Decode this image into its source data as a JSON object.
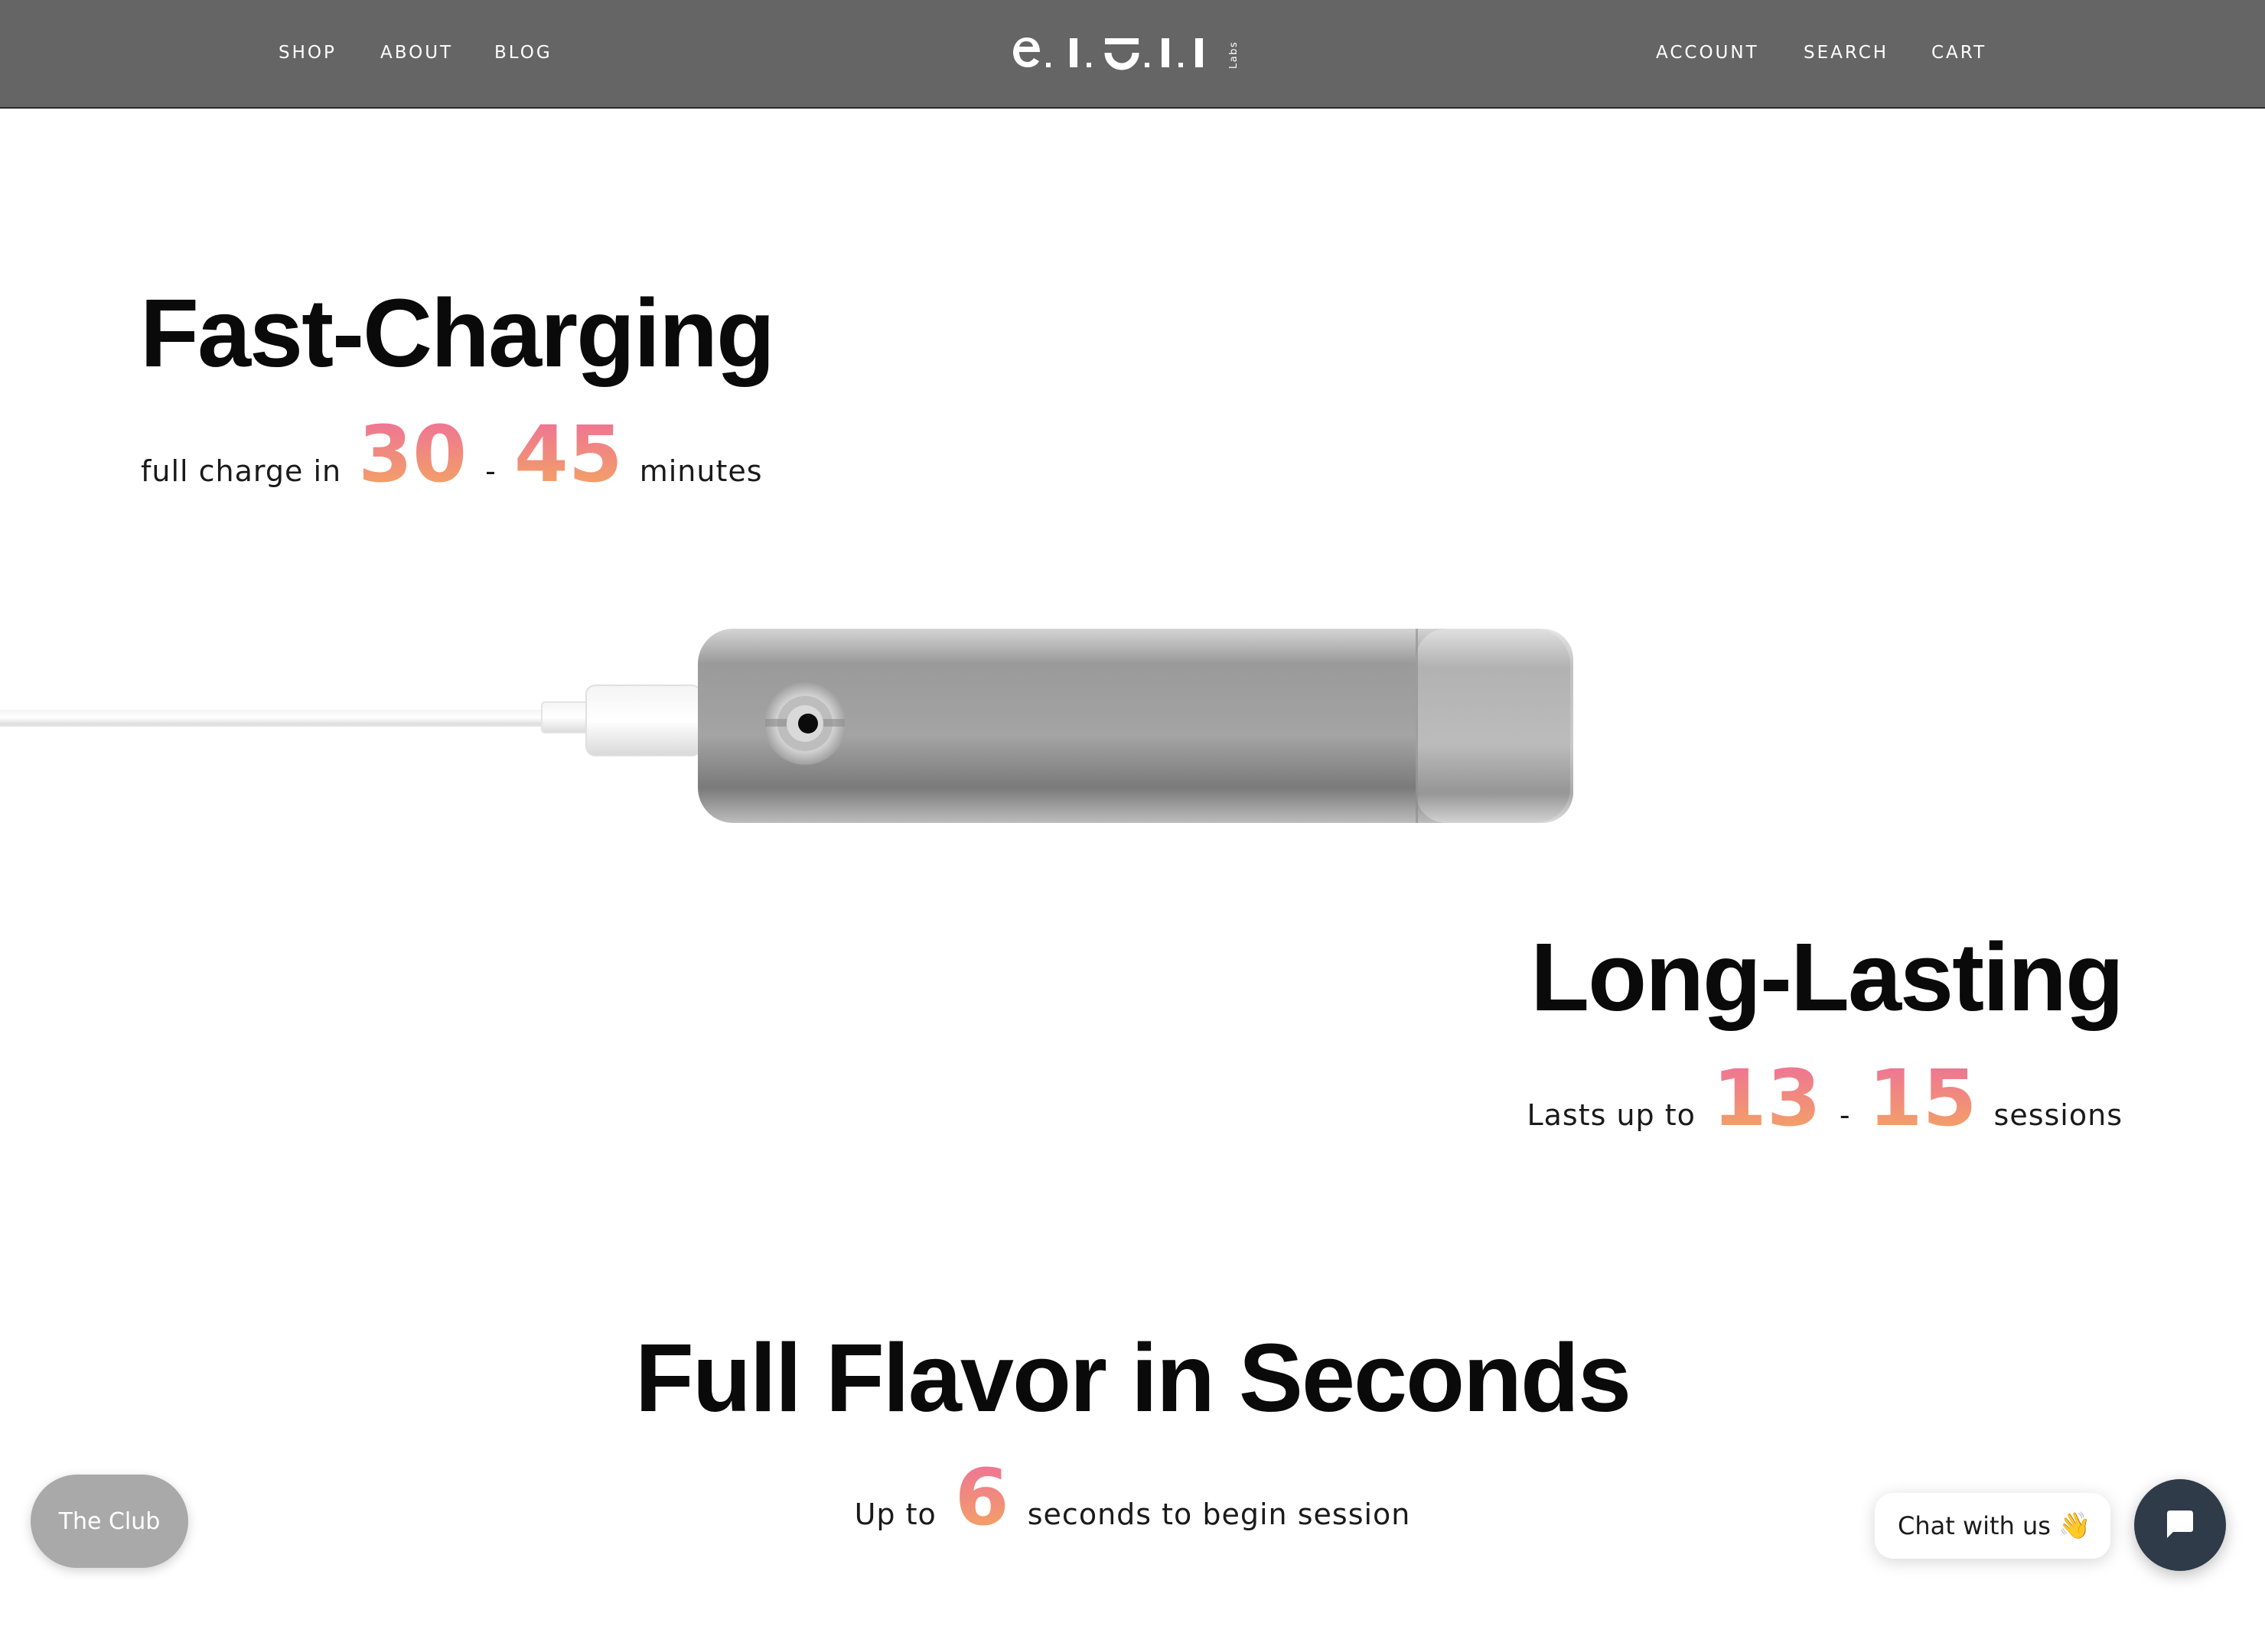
{
  "header": {
    "left_nav": [
      "SHOP",
      "ABOUT",
      "BLOG"
    ],
    "right_nav": [
      "ACCOUNT",
      "SEARCH",
      "CART"
    ],
    "logo": {
      "text": "e.I.O.I.I",
      "sub": "Labs"
    },
    "background": "#656565"
  },
  "features": [
    {
      "title": "Fast-Charging",
      "prefix": "full charge in",
      "value_low": "30",
      "separator": "-",
      "value_high": "45",
      "suffix": "minutes"
    },
    {
      "title": "Long-Lasting",
      "prefix": "Lasts up to",
      "value_low": "13",
      "separator": "-",
      "value_high": "15",
      "suffix": "sessions"
    },
    {
      "title": "Full Flavor in Seconds",
      "prefix": "Up to",
      "value": "6",
      "suffix": "seconds to begin session"
    }
  ],
  "gradient": {
    "from": "#ee6f9a",
    "to": "#f3a85f"
  },
  "widgets": {
    "club_label": "The Club",
    "chat_label": "Chat with us",
    "chat_emoji": "👋",
    "chat_button_color": "#2f3b49"
  },
  "icons": [
    "chat-icon",
    "wave-emoji-icon"
  ]
}
